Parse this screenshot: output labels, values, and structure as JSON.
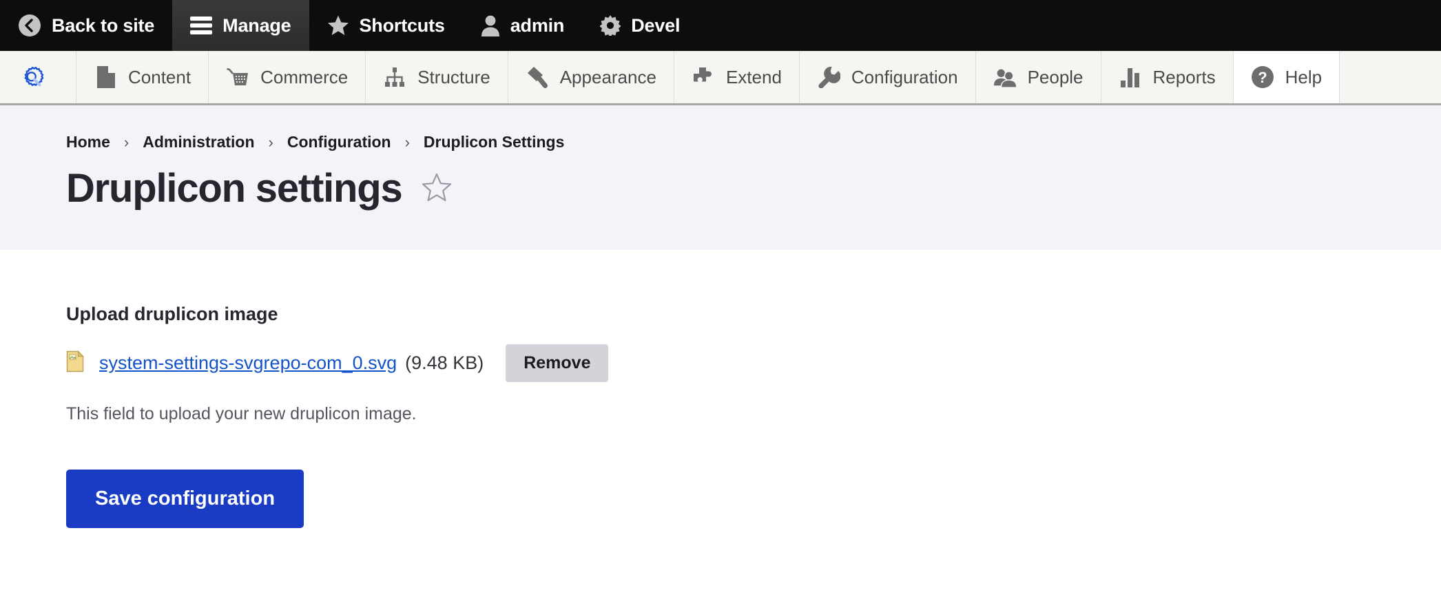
{
  "toolbar": {
    "items": [
      {
        "label": "Back to site",
        "icon": "back-circle-icon",
        "active": false
      },
      {
        "label": "Manage",
        "icon": "hamburger-icon",
        "active": true
      },
      {
        "label": "Shortcuts",
        "icon": "star-icon",
        "active": false
      },
      {
        "label": "admin",
        "icon": "user-icon",
        "active": false
      },
      {
        "label": "Devel",
        "icon": "gear-icon",
        "active": false
      }
    ]
  },
  "admin_menu": {
    "items": [
      {
        "label": "",
        "icon": "drupal-gear-icon"
      },
      {
        "label": "Content",
        "icon": "page-icon"
      },
      {
        "label": "Commerce",
        "icon": "cart-icon"
      },
      {
        "label": "Structure",
        "icon": "structure-icon"
      },
      {
        "label": "Appearance",
        "icon": "paintbrush-icon"
      },
      {
        "label": "Extend",
        "icon": "puzzle-icon"
      },
      {
        "label": "Configuration",
        "icon": "wrench-icon"
      },
      {
        "label": "People",
        "icon": "people-icon"
      },
      {
        "label": "Reports",
        "icon": "bar-chart-icon"
      },
      {
        "label": "Help",
        "icon": "question-circle-icon"
      }
    ]
  },
  "page_header": {
    "breadcrumb": [
      "Home",
      "Administration",
      "Configuration",
      "Druplicon Settings"
    ],
    "breadcrumb_separator": "›",
    "title": "Druplicon settings",
    "bookmark_icon": "star-outline-icon"
  },
  "form": {
    "upload_label": "Upload druplicon image",
    "file_icon": "file-icon",
    "file_name": "system-settings-svgrepo-com_0.svg",
    "file_size": "(9.48 KB)",
    "remove_label": "Remove",
    "description": "This field to upload your new druplicon image.",
    "save_label": "Save configuration"
  },
  "colors": {
    "toolbar_bg": "#0d0d0d",
    "toolbar_active_bg": "#333333",
    "menu_bg": "#f5f5f2",
    "header_bg": "#f3f4f9",
    "primary_button": "#1a3bc4",
    "link": "#1353ca",
    "remove_button": "#d3d4d9",
    "drupal_blue_icon": "#1a53d8"
  }
}
